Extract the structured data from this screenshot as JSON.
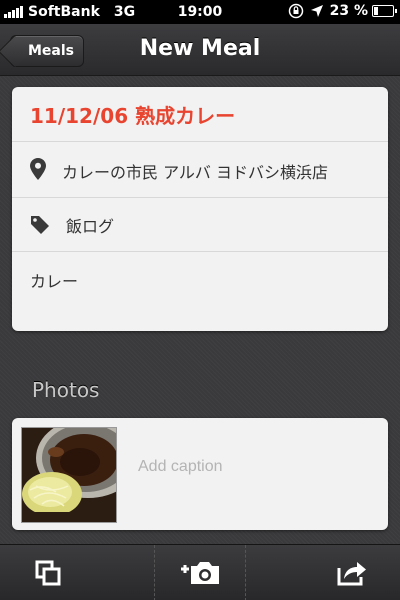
{
  "status_bar": {
    "carrier": "SoftBank",
    "network": "3G",
    "time": "19:00",
    "battery": "23 %",
    "battery_level": 0.23
  },
  "nav": {
    "back_label": "Meals",
    "title": "New Meal"
  },
  "meal": {
    "title": "11/12/06 熟成カレー",
    "location": "カレーの市民 アルバ ヨドバシ横浜店",
    "tag": "飯ログ",
    "category": "カレー"
  },
  "photos": {
    "section_label": "Photos",
    "caption_placeholder": "Add caption",
    "caption_value": ""
  },
  "icons": {
    "location": "map-pin-icon",
    "tag": "tag-icon",
    "copy": "copy-icon",
    "camera": "add-photo-icon",
    "share": "share-icon"
  },
  "colors": {
    "title_red": "#e8442f",
    "background": "#3a3a3c"
  }
}
